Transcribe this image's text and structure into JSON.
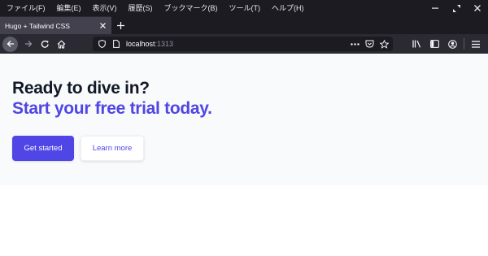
{
  "menubar": {
    "items": [
      "ファイル(F)",
      "編集(E)",
      "表示(V)",
      "履歴(S)",
      "ブックマーク(B)",
      "ツール(T)",
      "ヘルプ(H)"
    ]
  },
  "tab": {
    "title": "Hugo + Tailwind CSS"
  },
  "urlbar": {
    "host": "localhost",
    "port": ":1313"
  },
  "hero": {
    "heading_line1": "Ready to dive in?",
    "heading_line2": "Start your free trial today.",
    "primary_button": "Get started",
    "secondary_button": "Learn more"
  },
  "colors": {
    "accent": "#4f46e5",
    "heading": "#111827",
    "hero_bg": "#f9fafb",
    "chrome_bg": "#1c1b22",
    "toolbar_bg": "#2b2a33"
  },
  "icons": {
    "window": [
      "minimize-icon",
      "restore-icon",
      "close-icon"
    ],
    "nav": [
      "back-arrow-icon",
      "forward-arrow-icon",
      "reload-icon",
      "home-icon"
    ],
    "url": [
      "shield-icon",
      "page-icon",
      "more-icon",
      "pocket-icon",
      "star-icon"
    ],
    "toolbar": [
      "library-icon",
      "sidebar-icon",
      "account-icon",
      "hamburger-menu-icon"
    ]
  }
}
